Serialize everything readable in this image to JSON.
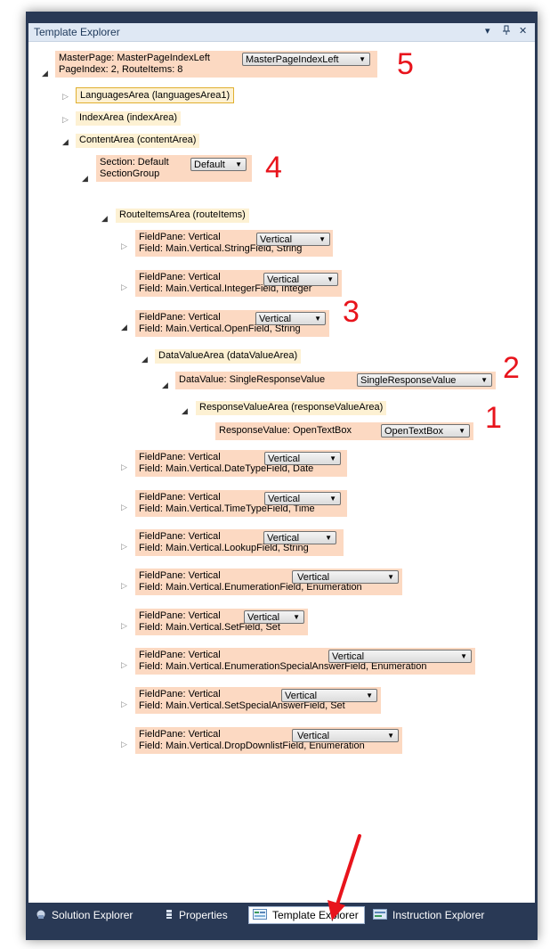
{
  "panel": {
    "title": "Template Explorer",
    "dropdown_glyph": "▾",
    "pin_glyph": "Ѩ",
    "close_glyph": "✕"
  },
  "tree": {
    "root": {
      "line1": "MasterPage: MasterPageIndexLeft",
      "line2": "PageIndex: 2, RouteItems: 8",
      "dropdown": "MasterPageIndexLeft"
    },
    "languages_area": "LanguagesArea (languagesArea1)",
    "index_area": "IndexArea (indexArea)",
    "content_area": "ContentArea (contentArea)",
    "section": {
      "line1": "Section: Default",
      "line2": "SectionGroup",
      "dropdown": "Default"
    },
    "route_items_area": "RouteItemsArea (routeItems)",
    "field_panes": [
      {
        "line1": "FieldPane: Vertical",
        "line2": "Field: Main.Vertical.StringField, String",
        "dropdown": "Vertical"
      },
      {
        "line1": "FieldPane: Vertical",
        "line2": "Field: Main.Vertical.IntegerField, Integer",
        "dropdown": "Vertical"
      },
      {
        "line1": "FieldPane: Vertical",
        "line2": "Field: Main.Vertical.OpenField, String",
        "dropdown": "Vertical"
      },
      {
        "line1": "FieldPane: Vertical",
        "line2": "Field: Main.Vertical.DateTypeField, Date",
        "dropdown": "Vertical"
      },
      {
        "line1": "FieldPane: Vertical",
        "line2": "Field: Main.Vertical.TimeTypeField, Time",
        "dropdown": "Vertical"
      },
      {
        "line1": "FieldPane: Vertical",
        "line2": "Field: Main.Vertical.LookupField, String",
        "dropdown": "Vertical"
      },
      {
        "line1": "FieldPane: Vertical",
        "line2": "Field: Main.Vertical.EnumerationField, Enumeration",
        "dropdown": "Vertical"
      },
      {
        "line1": "FieldPane: Vertical",
        "line2": "Field: Main.Vertical.SetField, Set",
        "dropdown": "Vertical"
      },
      {
        "line1": "FieldPane: Vertical",
        "line2": "Field: Main.Vertical.EnumerationSpecialAnswerField, Enumeration",
        "dropdown": "Vertical"
      },
      {
        "line1": "FieldPane: Vertical",
        "line2": "Field: Main.Vertical.SetSpecialAnswerField, Set",
        "dropdown": "Vertical"
      },
      {
        "line1": "FieldPane: Vertical",
        "line2": "Field: Main.Vertical.DropDownlistField, Enumeration",
        "dropdown": "Vertical"
      }
    ],
    "data_value_area": "DataValueArea (dataValueArea)",
    "data_value": {
      "label": "DataValue: SingleResponseValue",
      "dropdown": "SingleResponseValue"
    },
    "response_value_area": "ResponseValueArea (responseValueArea)",
    "response_value": {
      "label": "ResponseValue: OpenTextBox",
      "dropdown": "OpenTextBox"
    }
  },
  "annotations": {
    "n1": "1",
    "n2": "2",
    "n3": "3",
    "n4": "4",
    "n5": "5"
  },
  "tabs": [
    {
      "label": "Solution Explorer",
      "icon": "solution-explorer-icon"
    },
    {
      "label": "Properties",
      "icon": "properties-icon"
    },
    {
      "label": "Template Explorer",
      "icon": "template-explorer-icon"
    },
    {
      "label": "Instruction Explorer",
      "icon": "instruction-explorer-icon"
    }
  ],
  "colors": {
    "frame": "#293955",
    "node_orange": "#fcd9c2",
    "node_yellow": "#fdf1d3",
    "annotation": "#e8141c"
  }
}
